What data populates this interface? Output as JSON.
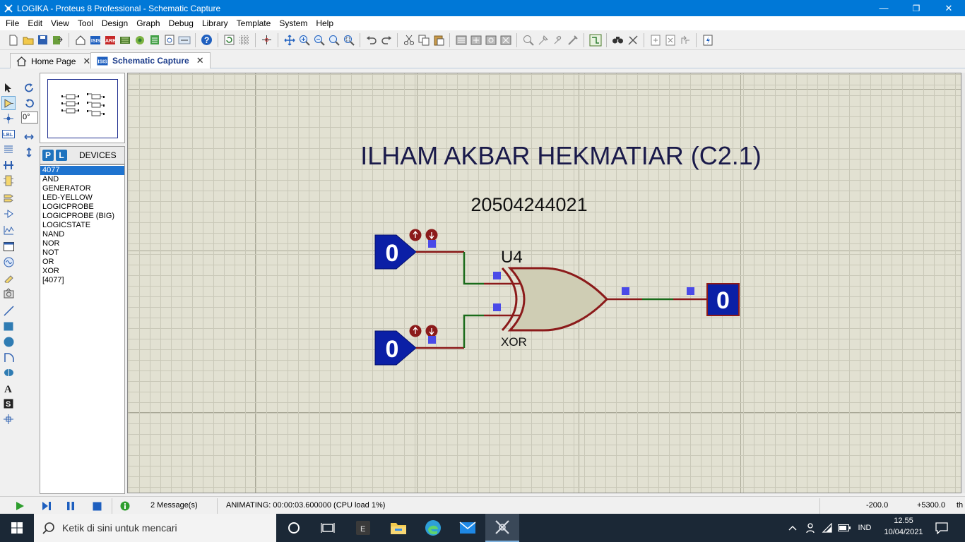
{
  "window": {
    "title": "LOGIKA - Proteus 8 Professional - Schematic Capture",
    "minimize": "—",
    "maximize": "❐",
    "close": "✕"
  },
  "menu": [
    "File",
    "Edit",
    "View",
    "Tool",
    "Design",
    "Graph",
    "Debug",
    "Library",
    "Template",
    "System",
    "Help"
  ],
  "tabs": [
    {
      "label": "Home Page",
      "close": "✕"
    },
    {
      "label": "Schematic Capture",
      "close": "✕"
    }
  ],
  "left_panel": {
    "angle": "0°",
    "p_button": "P",
    "l_button": "L",
    "devices_title": "DEVICES",
    "devices": [
      "4077",
      "AND",
      "GENERATOR",
      "LED-YELLOW",
      "LOGICPROBE",
      "LOGICPROBE (BIG)",
      "LOGICSTATE",
      "NAND",
      "NOR",
      "NOT",
      "OR",
      "XOR",
      "[4077]"
    ],
    "selected_device": "4077"
  },
  "schematic": {
    "title": "ILHAM AKBAR HEKMATIAR (C2.1)",
    "subtitle": "20504244021",
    "gate_ref": "U4",
    "gate_type": "XOR",
    "input_a_state": "0",
    "input_b_state": "0",
    "output_state": "0",
    "colors": {
      "wire": "#8b1a1a",
      "wire_low": "#1a6b1a",
      "logic_state_fill": "#0b1fa6",
      "gate_fill": "#cfcdb4",
      "gate_stroke": "#8b1a1a",
      "pin_marker": "#4a4ae8",
      "text_navy": "#1a1a4a"
    }
  },
  "status": {
    "messages": "2 Message(s)",
    "animating": "ANIMATING: 00:00:03.600000 (CPU load 1%)",
    "coord_x": "-200.0",
    "coord_y": "+5300.0",
    "unit": "th"
  },
  "taskbar": {
    "search_placeholder": "Ketik di sini untuk mencari",
    "language": "IND",
    "time": "12.55",
    "date": "10/04/2021"
  }
}
